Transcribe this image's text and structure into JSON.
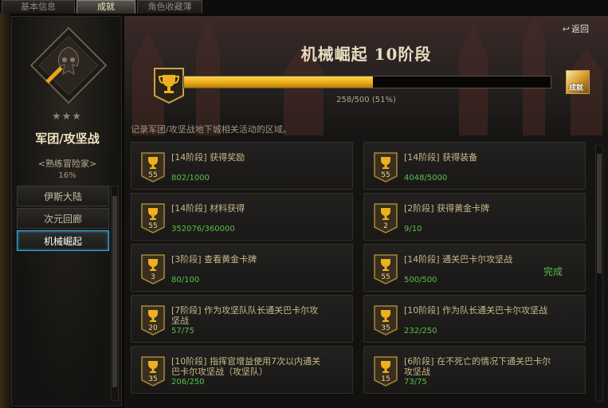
{
  "tabs": [
    {
      "label": "基本信息"
    },
    {
      "label": "成就"
    },
    {
      "label": "角色收藏薄"
    }
  ],
  "sidebar": {
    "category_title": "军团/攻坚战",
    "rank": "<熟练冒险家>",
    "percent": "16%",
    "stars": "★★★",
    "items": [
      {
        "label": "伊斯大陆"
      },
      {
        "label": "次元回廊"
      },
      {
        "label": "机械崛起"
      }
    ],
    "active_index": 2
  },
  "header": {
    "back_label": "返回",
    "stage_title": "机械崛起 10阶段",
    "progress_text": "258/500 (51%)",
    "progress_fraction": 0.516,
    "cap_label": "成就",
    "description": "记录军团/攻坚战地下城相关活动的区域。"
  },
  "achievements": [
    {
      "badge": "55",
      "title": "[14阶段] 获得奖励",
      "progress": "802/1000",
      "done": ""
    },
    {
      "badge": "55",
      "title": "[14阶段] 获得装备",
      "progress": "4048/5000",
      "done": ""
    },
    {
      "badge": "55",
      "title": "[14阶段] 材料获得",
      "progress": "352076/360000",
      "done": ""
    },
    {
      "badge": "2",
      "title": "[2阶段] 获得黄金卡牌",
      "progress": "9/10",
      "done": ""
    },
    {
      "badge": "3",
      "title": "[3阶段] 查看黄金卡牌",
      "progress": "80/100",
      "done": ""
    },
    {
      "badge": "55",
      "title": "[14阶段] 通关巴卡尔攻坚战",
      "progress": "500/500",
      "done": "完成"
    },
    {
      "badge": "20",
      "title": "[7阶段] 作为攻坚队队长通关巴卡尔攻坚战",
      "progress": "57/75",
      "done": ""
    },
    {
      "badge": "35",
      "title": "[10阶段] 作为队长通关巴卡尔攻坚战",
      "progress": "232/250",
      "done": ""
    },
    {
      "badge": "35",
      "title": "[10阶段] 指挥官增益使用7次以内通关巴卡尔攻坚战（攻坚队）",
      "progress": "206/250",
      "done": ""
    },
    {
      "badge": "15",
      "title": "[6阶段] 在不死亡的情况下通关巴卡尔攻坚战",
      "progress": "73/75",
      "done": ""
    }
  ],
  "colors": {
    "accent_gold": "#e8a814",
    "done_green": "#56c24a",
    "active_border": "#2fa8d8"
  }
}
